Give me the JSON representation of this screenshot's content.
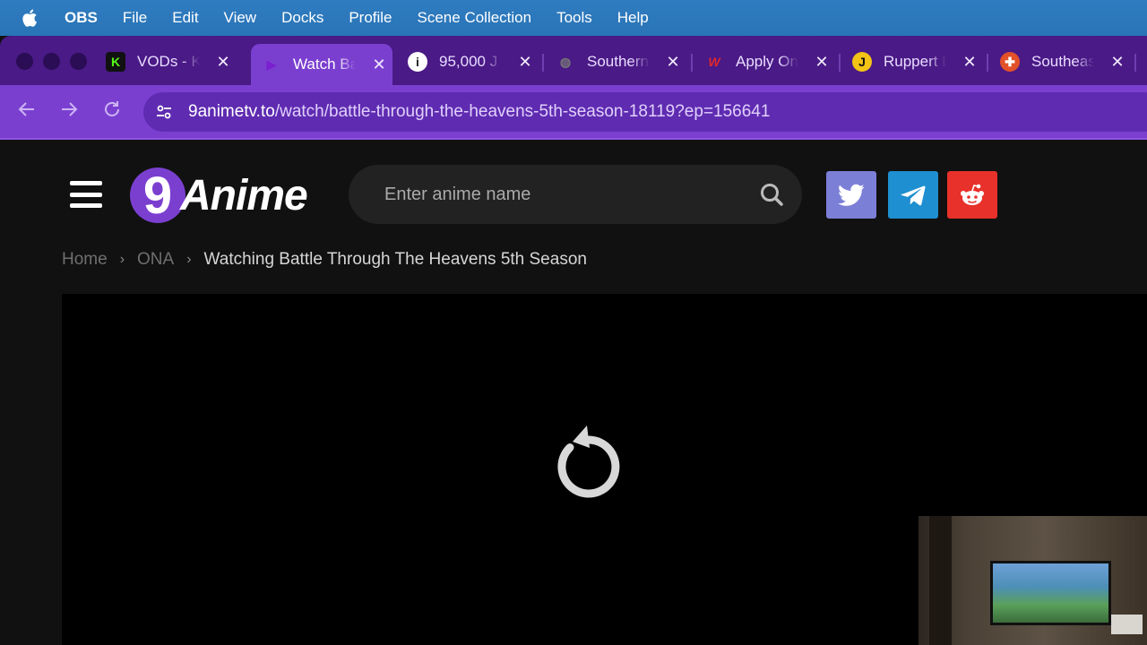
{
  "menubar": {
    "app": "OBS",
    "items": [
      "File",
      "Edit",
      "View",
      "Docks",
      "Profile",
      "Scene Collection",
      "Tools",
      "Help"
    ]
  },
  "tabs": [
    {
      "title": "VODs - K",
      "icon": "kick-icon",
      "fav_text": "K",
      "fav_bg": "#111111",
      "fav_color": "#53fc18"
    },
    {
      "title": "Watch Ba",
      "icon": "play-icon",
      "fav_text": "▶",
      "fav_bg": "transparent",
      "fav_color": "#7b1fd0",
      "active": true
    },
    {
      "title": "95,000 J",
      "icon": "info-icon",
      "fav_text": "i",
      "fav_bg": "#ffffff",
      "fav_color": "#222222"
    },
    {
      "title": "Southern",
      "icon": "globe-icon",
      "fav_text": "◍",
      "fav_bg": "transparent",
      "fav_color": "#777777"
    },
    {
      "title": "Apply On",
      "icon": "w-logo-icon",
      "fav_text": "W",
      "fav_bg": "transparent",
      "fav_color": "#e0282e"
    },
    {
      "title": "Ruppert L",
      "icon": "j-logo-icon",
      "fav_text": "J",
      "fav_bg": "#f3c316",
      "fav_color": "#111111"
    },
    {
      "title": "Southeas",
      "icon": "lifebuoy-icon",
      "fav_text": "✚",
      "fav_bg": "#e2512a",
      "fav_color": "#ffffff"
    }
  ],
  "tab_close_glyph": "✕",
  "address": {
    "host": "9animetv.to",
    "path": "/watch/battle-through-the-heavens-5th-season-18119?ep=156641"
  },
  "site": {
    "logo_digit": "9",
    "logo_word": "Anime",
    "search_placeholder": "Enter anime name",
    "social": [
      {
        "name": "twitter-button",
        "icon": "twitter-icon",
        "color": "#7c7fd6"
      },
      {
        "name": "telegram-button",
        "icon": "telegram-icon",
        "color": "#1e8fd0"
      },
      {
        "name": "reddit-button",
        "icon": "reddit-icon",
        "color": "#e8312a"
      }
    ]
  },
  "breadcrumb": {
    "home": "Home",
    "category": "ONA",
    "current": "Watching Battle Through The Heavens 5th Season",
    "separator": "›"
  }
}
